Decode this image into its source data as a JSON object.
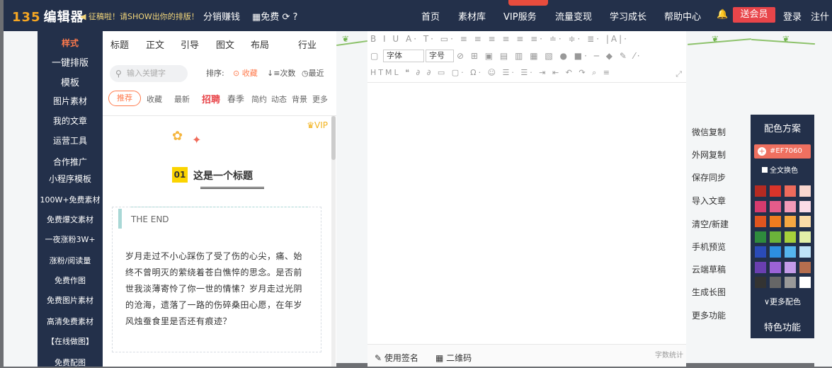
{
  "topbar": {
    "logo_num": "135",
    "logo_text": "编辑器",
    "promo": "◀ 征稿啦！请SHOW出你的排版！",
    "links": [
      "分销赚钱",
      "免费",
      "首页",
      "素材库",
      "VIP服务",
      "流量变现",
      "学习成长",
      "帮助中心"
    ],
    "vip_button": "送会员",
    "login": "登录",
    "register": "注什"
  },
  "leftnav": {
    "items": [
      "样式",
      "一键排版",
      "模板",
      "图片素材",
      "我的文章",
      "运营工具",
      "合作推广",
      "小程序模板",
      "100W+免费素材",
      "免费爆文素材",
      "一夜涨粉3W+",
      "涨粉/阅读量",
      "免费作图",
      "免费图片素材",
      "高清免费素材",
      "【在线做图】",
      "免费配图"
    ]
  },
  "panel": {
    "tabs": [
      "标题",
      "正文",
      "引导",
      "图文",
      "布局",
      "行业"
    ],
    "search_placeholder": "输入关键字",
    "sort_label": "排序:",
    "sort_options": [
      "收藏",
      "次数",
      "最近"
    ],
    "filters": [
      "推荐",
      "收藏",
      "最新",
      "招聘",
      "春季",
      "简约",
      "动态",
      "背景",
      "更多"
    ],
    "vip": "VIP",
    "title_num": "01",
    "title_text": "这是一个标题",
    "end_text": "THE END",
    "poem": "岁月走过不小心踩伤了受了伤的心尖，痛、始终不曾明灭的萦绕着苍白憔悴的思念。是否前世我淡薄寄怜了你一世的情愫？岁月走过光阴的沧海，遗落了一路的伤碎桑田心愿，在年岁风烛蚕食里是否还有痕迹？"
  },
  "editor": {
    "font_label": "字体",
    "size_label": "字号",
    "footer_sign": "使用签名",
    "footer_qr": "二维码",
    "footer_count": "字数统计"
  },
  "actions": [
    "微信复制",
    "外网复制",
    "保存同步",
    "导入文章",
    "清空/新建",
    "手机预览",
    "云端草稿",
    "生成长图",
    "更多功能"
  ],
  "colors": {
    "title": "配色方案",
    "current": "#EF7060",
    "all_change": "全文换色",
    "more": "更多配色",
    "feature": "特色功能",
    "swatches": [
      [
        "#b52a22",
        "#d9342a",
        "#ee6b5c",
        "#f7d6cf"
      ],
      [
        "#d63b6e",
        "#e55c8a",
        "#f29ab8",
        "#fbdbe6"
      ],
      [
        "#e0551f",
        "#f07c1f",
        "#f5a742",
        "#fbdca8"
      ],
      [
        "#2e8b3d",
        "#6bb33a",
        "#a5cf3b",
        "#e2f0a8"
      ],
      [
        "#2a4bb8",
        "#2d8fe0",
        "#55b6ee",
        "#bfe3f7"
      ],
      [
        "#6a3fb0",
        "#9b63d6",
        "#c49be8",
        "#b56e4e"
      ],
      [
        "#333333",
        "#666666",
        "#999999",
        "#ffffff"
      ]
    ]
  }
}
